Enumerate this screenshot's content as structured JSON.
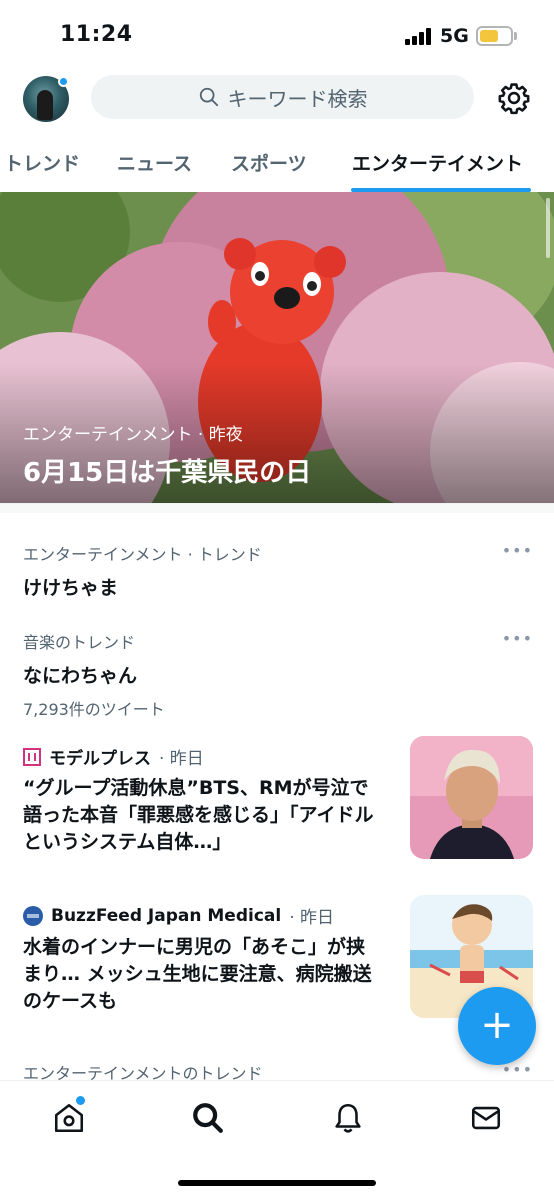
{
  "status_bar": {
    "time": "11:24",
    "network": "5G"
  },
  "header": {
    "search_placeholder": "キーワード検索"
  },
  "tabs": [
    {
      "label": "トレンド"
    },
    {
      "label": "ニュース"
    },
    {
      "label": "スポーツ"
    },
    {
      "label": "エンターテイメント"
    }
  ],
  "hero": {
    "meta": "エンターテインメント · 昨夜",
    "title": "6月15日は千葉県民の日"
  },
  "trends": [
    {
      "meta": "エンターテインメント · トレンド",
      "title": "けけちゃま",
      "count": ""
    },
    {
      "meta": "音楽のトレンド",
      "title": "なにわちゃん",
      "count": "7,293件のツイート"
    }
  ],
  "news": [
    {
      "source": "モデルプレス",
      "time": "· 昨日",
      "title": "“グループ活動休息”BTS、RMが号泣で語った本音「罪悪感を感じる」「アイドルというシステム自体…」"
    },
    {
      "source": "BuzzFeed Japan Medical",
      "time": "· 昨日",
      "title": "水着のインナーに男児の「あそこ」が挟まり… メッシュ生地に要注意、病院搬送のケースも"
    }
  ],
  "next_section": {
    "label": "エンターテインメントのトレンド"
  },
  "fab": {
    "label": "+"
  },
  "more_label": "•••",
  "colors": {
    "accent": "#1d9bf0",
    "text": "#0f1419",
    "muted": "#536471"
  },
  "icons": [
    "search-icon",
    "gear-icon",
    "home-icon",
    "search-nav-icon",
    "bell-icon",
    "mail-icon",
    "more-icon"
  ]
}
